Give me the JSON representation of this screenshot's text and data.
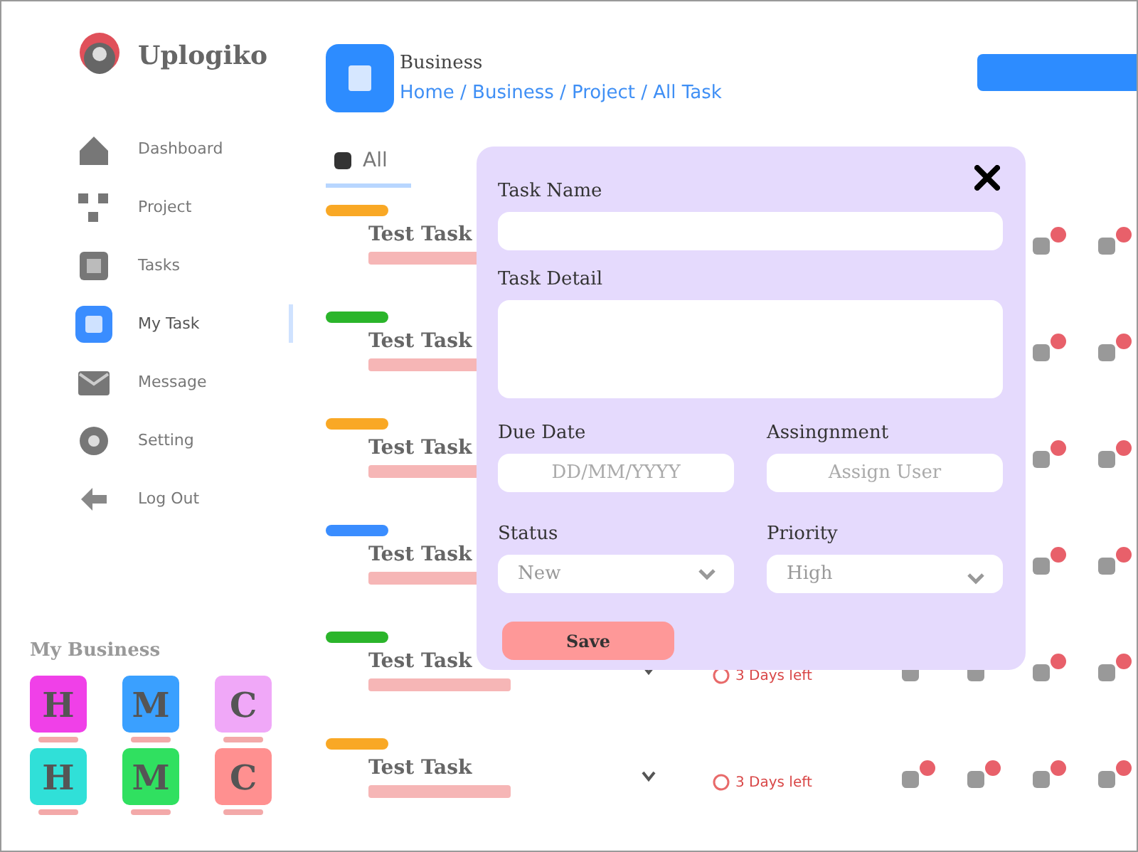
{
  "app": {
    "name": "Uplogiko"
  },
  "sidebar": {
    "items": [
      {
        "label": "Dashboard",
        "selected": false
      },
      {
        "label": "Project",
        "selected": false
      },
      {
        "label": "Tasks",
        "selected": false
      },
      {
        "label": "My Task",
        "selected": true
      },
      {
        "label": "Message",
        "selected": false
      },
      {
        "label": "Setting",
        "selected": false
      },
      {
        "label": "Log Out",
        "selected": false
      }
    ]
  },
  "my_business": {
    "title": "My Business",
    "items": [
      {
        "letter": "H",
        "color": "#f040e8"
      },
      {
        "letter": "M",
        "color": "#3aa0ff"
      },
      {
        "letter": "C",
        "color": "#f0a8f8"
      },
      {
        "letter": "H",
        "color": "#30e0d8"
      },
      {
        "letter": "M",
        "color": "#30e060"
      },
      {
        "letter": "C",
        "color": "#ff9090"
      }
    ]
  },
  "header": {
    "title": "Business",
    "breadcrumb": "Home / Business / Project / All Task"
  },
  "tabs": [
    {
      "label": "All",
      "selected": true
    }
  ],
  "tasks": [
    {
      "title": "Test Task",
      "color": "#f9a825"
    },
    {
      "title": "Test Task",
      "color": "#2bb52b"
    },
    {
      "title": "Test Task",
      "color": "#f9a825"
    },
    {
      "title": "Test Task",
      "color": "#3a8dff"
    },
    {
      "title": "Test Task",
      "color": "#2bb52b",
      "due": "3 Days left"
    },
    {
      "title": "Test Task",
      "color": "#f9a825",
      "due": "3 Days left"
    }
  ],
  "dialog": {
    "task_name": {
      "label": "Task Name"
    },
    "task_detail": {
      "label": "Task Detail"
    },
    "due_date": {
      "label": "Due Date",
      "placeholder": "DD/MM/YYYY"
    },
    "assignment": {
      "label": "Assingnment",
      "placeholder": "Assign User"
    },
    "status": {
      "label": "Status",
      "value": "New"
    },
    "priority": {
      "label": "Priority",
      "value": "High"
    },
    "save_button": "Save"
  }
}
